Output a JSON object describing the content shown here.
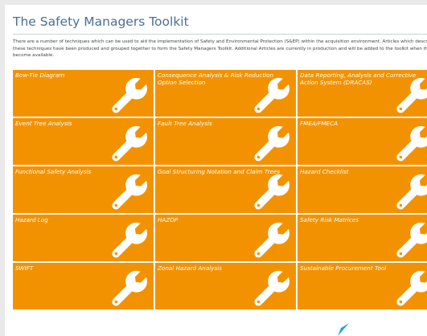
{
  "page": {
    "title": "The Safety Managers Toolkit",
    "intro": "There are a number of techniques which can be used to aid the implementation of Safety and Environmental Protection (S&EP) within the acquisition environment. Articles which describe these techniques have been produced and grouped together to form the Safety Managers Toolkit. Additional Articles are currently in production and will be added to the toolkit when they become available."
  },
  "colors": {
    "tile": "#f39200",
    "title": "#4a6f93",
    "cursor": "#1fa9c9"
  },
  "tiles": [
    {
      "label": "Bow-Tie Diagram",
      "icon": "wrench-icon"
    },
    {
      "label": "Consequence Analysis & Risk Reduction Option Selection",
      "icon": "wrench-icon"
    },
    {
      "label": "Data Reporting, Analysis and Corrective Action System (DRACAS)",
      "icon": "wrench-icon"
    },
    {
      "label": "Event Tree Analysis",
      "icon": "wrench-icon"
    },
    {
      "label": "Fault Tree Analysis",
      "icon": "wrench-icon"
    },
    {
      "label": "FMEA/FMECA",
      "icon": "wrench-icon"
    },
    {
      "label": "Functional Safety Analysis",
      "icon": "wrench-icon"
    },
    {
      "label": "Goal Structuring Notation and Claim Trees",
      "icon": "wrench-icon"
    },
    {
      "label": "Hazard Checklist",
      "icon": "wrench-icon"
    },
    {
      "label": "Hazard Log",
      "icon": "wrench-icon"
    },
    {
      "label": "HAZOP",
      "icon": "wrench-icon"
    },
    {
      "label": "Safety Risk Matrices",
      "icon": "wrench-icon"
    },
    {
      "label": "SWIFT",
      "icon": "wrench-icon"
    },
    {
      "label": "Zonal Hazard Analysis",
      "icon": "wrench-icon"
    },
    {
      "label": "Sustainable Procurement Tool",
      "icon": "wrench-icon"
    }
  ]
}
